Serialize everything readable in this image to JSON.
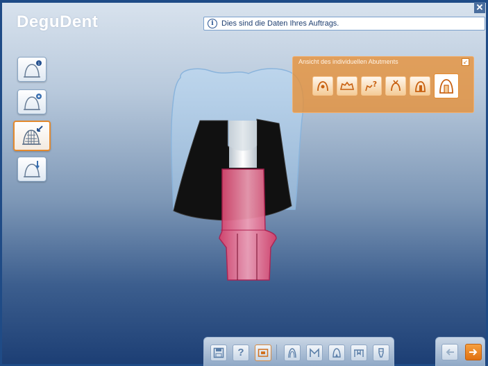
{
  "app": {
    "brand": "DeguDent"
  },
  "window": {
    "close_glyph": "✕"
  },
  "info": {
    "icon": "info-icon",
    "icon_glyph": "i",
    "message": "Dies sind die Daten Ihres Auftrags."
  },
  "left_toolbar": {
    "items": [
      {
        "name": "crown-info",
        "icon": "crown-info-icon",
        "active": false
      },
      {
        "name": "crown-settings",
        "icon": "crown-settings-icon",
        "active": false
      },
      {
        "name": "crown-mesh",
        "icon": "crown-mesh-icon",
        "active": true
      },
      {
        "name": "crown-edit",
        "icon": "crown-edit-icon",
        "active": false
      }
    ]
  },
  "view_panel": {
    "title": "Ansicht des individuellen Abutments",
    "pin_glyph": "↙",
    "views": [
      {
        "icon": "view-occlusal-icon",
        "selected": false
      },
      {
        "icon": "view-arch-icon",
        "selected": false
      },
      {
        "icon": "view-help-icon",
        "selected": false
      },
      {
        "icon": "view-lingual-icon",
        "selected": false
      },
      {
        "icon": "view-side-icon",
        "selected": false
      },
      {
        "icon": "view-section-icon",
        "selected": true
      }
    ]
  },
  "bottom_toolbar": {
    "help_label": "?",
    "items": [
      "save-icon",
      "help-icon",
      "screenshot-icon",
      "tooth-icon",
      "margin-icon",
      "crown-icon",
      "bridge-icon",
      "implant-icon"
    ]
  },
  "nav": {
    "back": "back-arrow-icon",
    "next": "next-arrow-icon"
  },
  "colors": {
    "accent": "#e48a2e",
    "frame": "#1f4b86",
    "abutment": "#e0507a",
    "crown": "#a8c8e8"
  }
}
